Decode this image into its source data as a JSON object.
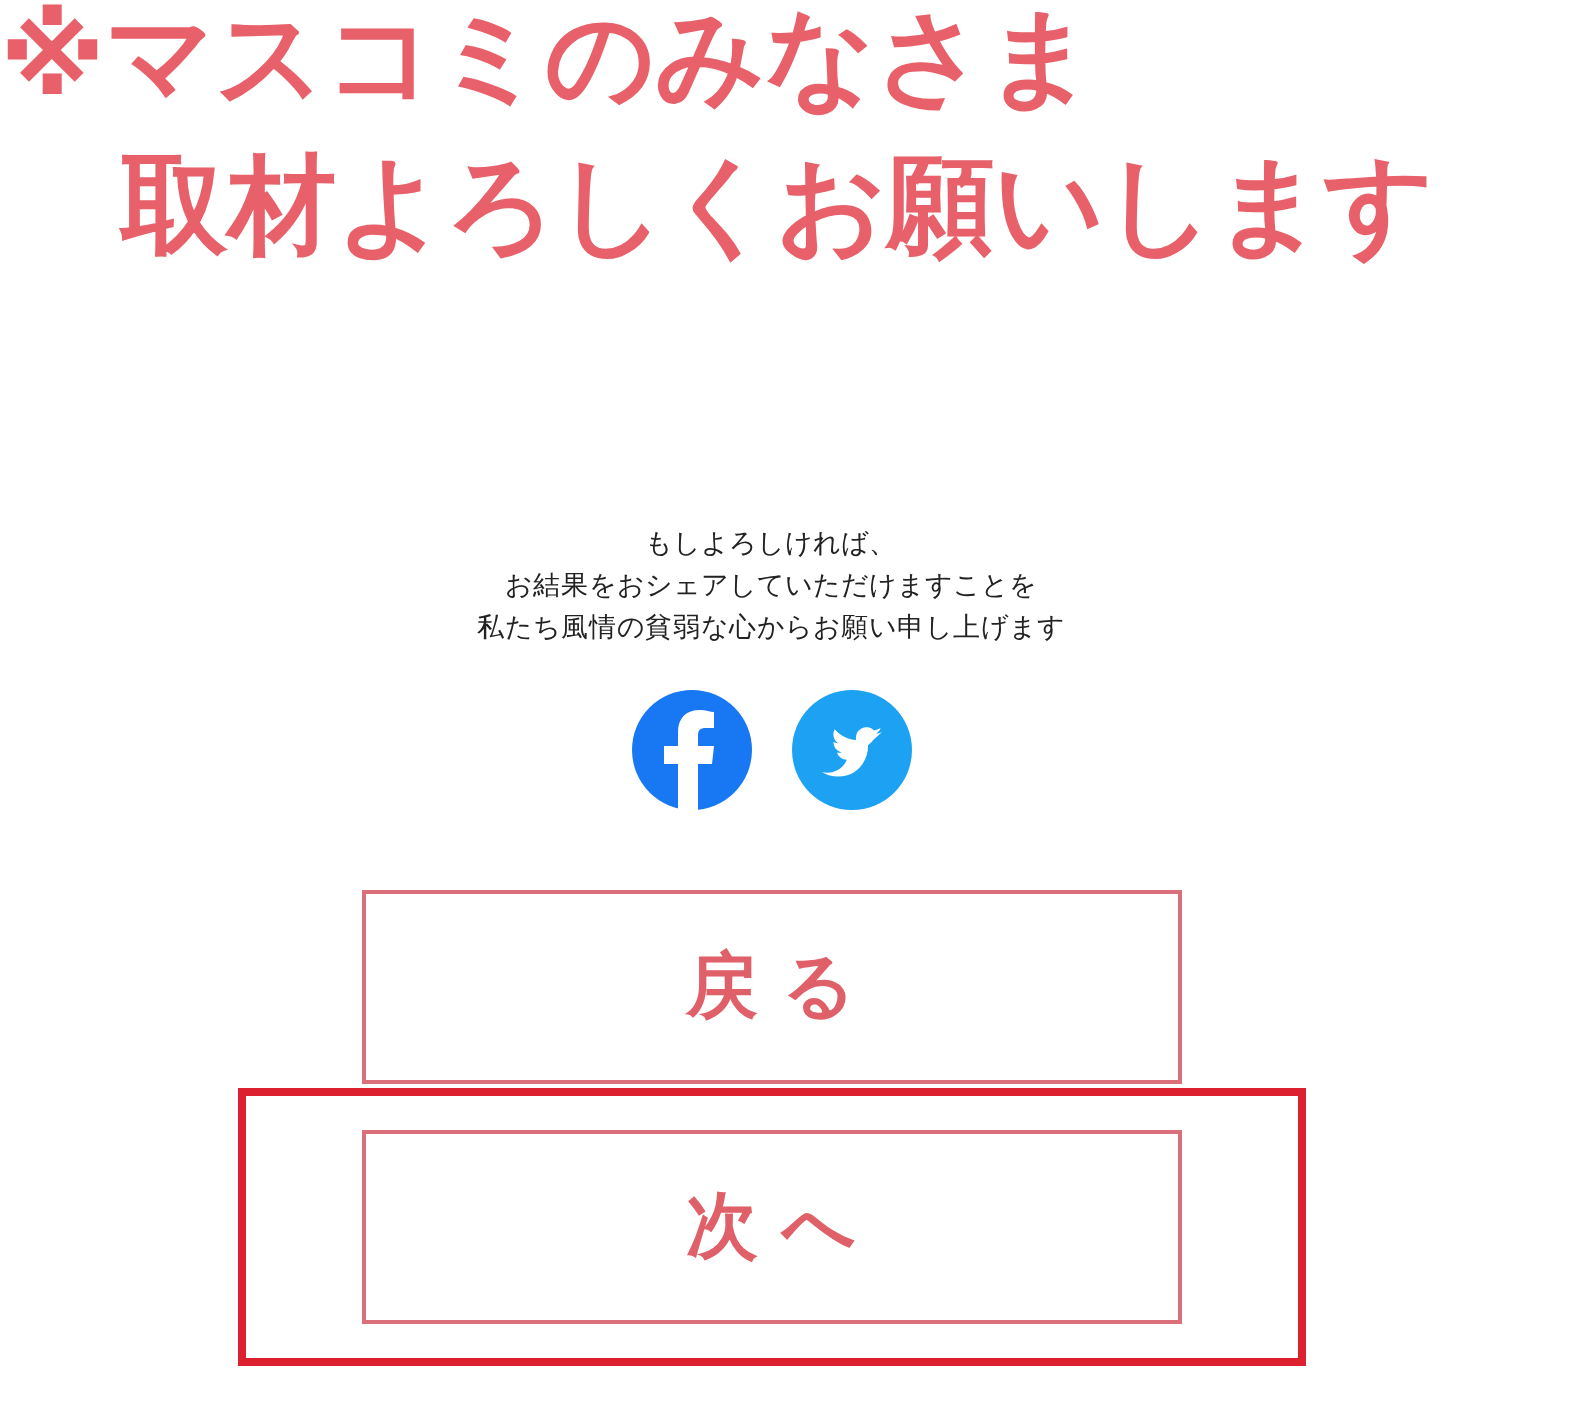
{
  "heading": [
    "※マスコミのみなさま",
    "取材よろしくお願いします"
  ],
  "message": [
    "もしよろしければ、",
    "お結果をおシェアしていただけますことを",
    "私たち風情の貧弱な心からお願い申し上げます"
  ],
  "share_icons": [
    {
      "kind": "facebook"
    },
    {
      "kind": "twitter"
    }
  ],
  "buttons": [
    {
      "label": "戻る",
      "highlighted": false
    },
    {
      "label": "次へ",
      "highlighted": true
    }
  ]
}
